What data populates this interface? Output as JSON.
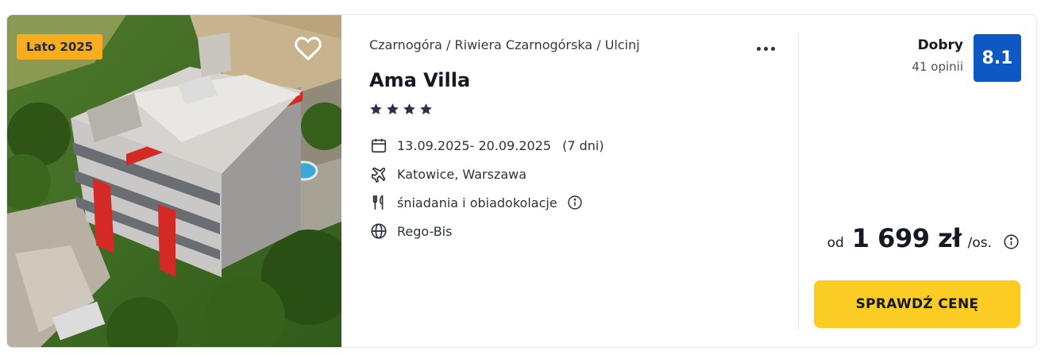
{
  "photo": {
    "alt": "Ama Villa",
    "season_badge": "Lato 2025",
    "favorite_icon": "heart-outline-icon"
  },
  "breadcrumb": {
    "items": [
      "Czarnogóra",
      "Riwiera Czarnogórska",
      "Ulcinj"
    ],
    "separator": " / "
  },
  "more_icon": "more-horizontal-icon",
  "hotel": {
    "name": "Ama Villa",
    "stars": 4
  },
  "details": {
    "dates": "13.09.2025- 20.09.2025",
    "duration": "(7 dni)",
    "airports": "Katowice, Warszawa",
    "board": "śniadania i obiadokolacje",
    "operator": "Rego-Bis",
    "icons": {
      "dates": "calendar-icon",
      "airports": "plane-icon",
      "board": "cutlery-icon",
      "operator": "globe-icon",
      "info": "info-icon"
    }
  },
  "rating": {
    "label": "Dobry",
    "reviews": "41 opinii",
    "score": "8.1",
    "badge_color": "#0e58c4"
  },
  "price": {
    "prefix": "od",
    "amount": "1 699 zł",
    "suffix": "/os."
  },
  "cta": {
    "label": "SPRAWDŹ CENĘ",
    "color": "#fbcc23"
  },
  "colors": {
    "season_badge": "#f7ad1f",
    "text_dark": "#151a22"
  }
}
